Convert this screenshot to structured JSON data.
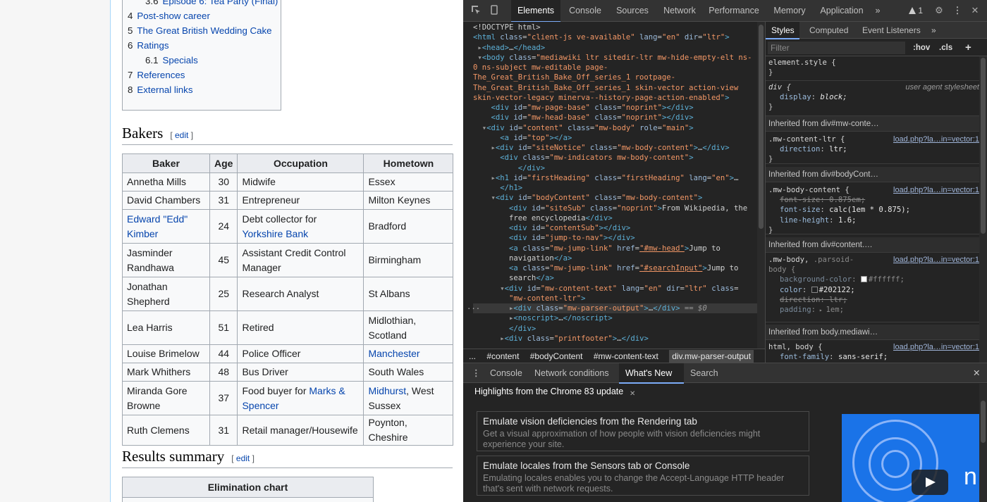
{
  "wiki": {
    "toc": [
      {
        "num": "3.6",
        "label": "Episode 6: Tea Party (Final)",
        "sub": true,
        "partial": true
      },
      {
        "num": "4",
        "label": "Post-show career",
        "sub": false
      },
      {
        "num": "5",
        "label": "The Great British Wedding Cake",
        "sub": false
      },
      {
        "num": "6",
        "label": "Ratings",
        "sub": false
      },
      {
        "num": "6.1",
        "label": "Specials",
        "sub": true
      },
      {
        "num": "7",
        "label": "References",
        "sub": false
      },
      {
        "num": "8",
        "label": "External links",
        "sub": false
      }
    ],
    "bakers_heading": "Bakers",
    "edit_label": "edit",
    "table": {
      "headers": [
        "Baker",
        "Age",
        "Occupation",
        "Hometown"
      ],
      "rows": [
        {
          "baker": "Annetha Mills",
          "age": "30",
          "occupation": "Midwife",
          "hometown": "Essex"
        },
        {
          "baker": "David Chambers",
          "age": "31",
          "occupation": "Entrepreneur",
          "hometown": "Milton Keynes"
        },
        {
          "baker": "Edward \"Edd\" Kimber",
          "age": "24",
          "occupation_pre": "Debt collector for ",
          "occupation_link": "Yorkshire Bank",
          "hometown": "Bradford"
        },
        {
          "baker": "Jasminder Randhawa",
          "age": "45",
          "occupation": "Assistant Credit Control Manager",
          "hometown": "Birmingham"
        },
        {
          "baker": "Jonathan Shepherd",
          "age": "25",
          "occupation": "Research Analyst",
          "hometown": "St Albans"
        },
        {
          "baker": "Lea Harris",
          "age": "51",
          "occupation": "Retired",
          "hometown": "Midlothian, Scotland"
        },
        {
          "baker": "Louise Brimelow",
          "age": "44",
          "occupation": "Police Officer",
          "hometown": "Manchester"
        },
        {
          "baker": "Mark Whithers",
          "age": "48",
          "occupation": "Bus Driver",
          "hometown": "South Wales"
        },
        {
          "baker": "Miranda Gore Browne",
          "age": "37",
          "occupation_pre": "Food buyer for ",
          "occupation_link": "Marks & Spencer",
          "hometown_link": "Midhurst",
          "hometown_post": ", West Sussex"
        },
        {
          "baker": "Ruth Clemens",
          "age": "31",
          "occupation": "Retail manager/Housewife",
          "hometown": "Poynton, Cheshire"
        }
      ]
    },
    "results_heading": "Results summary",
    "elimination_title": "Elimination chart"
  },
  "devtools": {
    "tabs": [
      "Elements",
      "Console",
      "Sources",
      "Network",
      "Performance",
      "Memory",
      "Application"
    ],
    "active_tab": "Elements",
    "more_tabs": "»",
    "warning_count": "1",
    "breadcrumb": [
      "...",
      "#content",
      "#bodyContent",
      "#mw-content-text",
      "div.mw-parser-output"
    ],
    "styles_tabs": [
      "Styles",
      "Computed",
      "Event Listeners",
      "»"
    ],
    "filter_placeholder": "Filter",
    "hov_label": ":hov",
    "cls_label": ".cls",
    "plus_label": "+",
    "styles": {
      "element_style": "element.style {",
      "close": "}",
      "div_selector": "div {",
      "ua_label": "user agent stylesheet",
      "display_prop": "display",
      "display_val": "block;",
      "inherit1": "Inherited from div#mw-conte…",
      "rule1_sel": ".mw-content-ltr {",
      "rule1_src": "load.php?la…in=vector:1",
      "rule1_prop": "direction",
      "rule1_val": "ltr;",
      "inherit2": "Inherited from div#bodyCont…",
      "rule2_sel": ".mw-body-content {",
      "rule2_src": "load.php?la…in=vector:1",
      "rule2_p1": "font-size",
      "rule2_v1": "0.875em;",
      "rule2_p2": "font-size",
      "rule2_v2": "calc(1em * 0.875);",
      "rule2_p3": "line-height",
      "rule2_v3": "1.6;",
      "inherit3": "Inherited from div#content.…",
      "rule3_sel": ".mw-body, ",
      "rule3_sel2": ".parsoid-",
      "rule3_sel3": "body {",
      "rule3_src": "load.php?la…in=vector:1",
      "rule3_p1": "background-color",
      "rule3_v1": "#ffffff;",
      "rule3_p2": "color",
      "rule3_v2": "#202122;",
      "rule3_p3": "direction",
      "rule3_v3": "ltr;",
      "rule3_p4": "padding",
      "rule3_v4": "1em;",
      "inherit4": "Inherited from body.mediawi…",
      "rule4_sel": "html, body {",
      "rule4_src": "load.php?la…in=vector:1",
      "rule4_p1": "font-family",
      "rule4_v1": "sans-serif;"
    },
    "drawer": {
      "tabs": [
        "Console",
        "Network conditions",
        "What's New",
        "Search"
      ],
      "active_tab": "What's New",
      "heading": "Highlights from the Chrome 83 update",
      "cards": [
        {
          "title": "Emulate vision deficiencies from the Rendering tab",
          "desc": "Get a visual approximation of how people with vision deficiencies might experience your site."
        },
        {
          "title": "Emulate locales from the Sensors tab or Console",
          "desc": "Emulating locales enables you to change the Accept-Language HTTP header that's sent with network requests."
        }
      ],
      "video_text": "n"
    }
  }
}
